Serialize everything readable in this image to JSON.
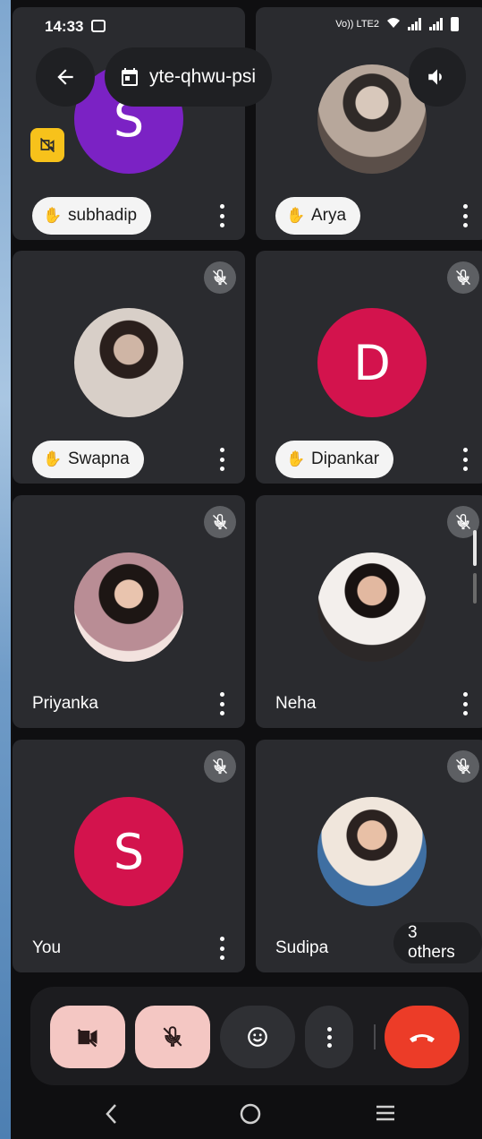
{
  "status_bar": {
    "time": "14:33",
    "network_label": "Vo)) LTE2"
  },
  "top_bar": {
    "meeting_code": "yte-qhwu-psi"
  },
  "participants": [
    {
      "name": "subhadip",
      "initial": "S",
      "avatar_color": "#7b22c4",
      "hand_raised": true
    },
    {
      "name": "Arya",
      "initial": "",
      "hand_raised": true
    },
    {
      "name": "Swapna",
      "initial": "",
      "hand_raised": true,
      "muted": true
    },
    {
      "name": "Dipankar",
      "initial": "D",
      "avatar_color": "#d3134d",
      "hand_raised": true,
      "muted": true
    },
    {
      "name": "Priyanka",
      "initial": "",
      "muted": true
    },
    {
      "name": "Neha",
      "initial": "",
      "muted": true
    },
    {
      "name": "You",
      "initial": "S",
      "avatar_color": "#d3134d",
      "muted": true
    },
    {
      "name": "Sudipa",
      "initial": "",
      "muted": true
    }
  ],
  "others_label": "3 others",
  "colors": {
    "end_call": "#ec3c28",
    "muted_control": "#f4c7c3",
    "cam_off_badge": "#f7c21b"
  }
}
